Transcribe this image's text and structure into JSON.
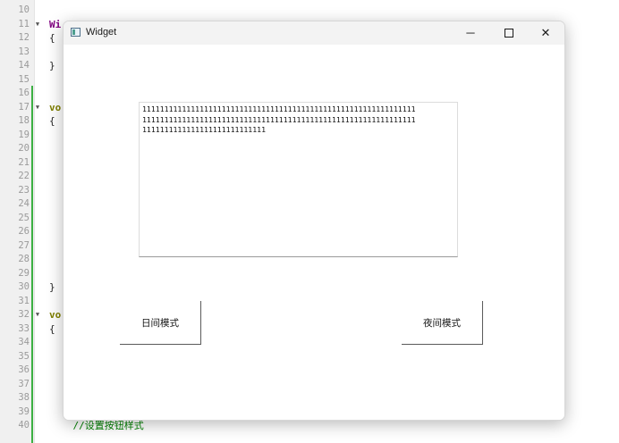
{
  "editor": {
    "lines": [
      {
        "n": "10",
        "text": "",
        "fold": ""
      },
      {
        "n": "11",
        "text": "Wi",
        "fold": "▼",
        "style": "kw-purple"
      },
      {
        "n": "12",
        "text": "{",
        "fold": ""
      },
      {
        "n": "13",
        "text": "",
        "fold": ""
      },
      {
        "n": "14",
        "text": "}",
        "fold": ""
      },
      {
        "n": "15",
        "text": "",
        "fold": ""
      },
      {
        "n": "16",
        "text": "",
        "fold": ""
      },
      {
        "n": "17",
        "text": "vo",
        "fold": "▼",
        "style": "kw-olive"
      },
      {
        "n": "18",
        "text": "{",
        "fold": ""
      },
      {
        "n": "19",
        "text": "",
        "fold": ""
      },
      {
        "n": "20",
        "text": "",
        "fold": ""
      },
      {
        "n": "21",
        "text": "",
        "fold": ""
      },
      {
        "n": "22",
        "text": "",
        "fold": ""
      },
      {
        "n": "23",
        "text": "",
        "fold": ""
      },
      {
        "n": "24",
        "text": "",
        "fold": ""
      },
      {
        "n": "25",
        "text": "",
        "fold": ""
      },
      {
        "n": "26",
        "text": "",
        "fold": ""
      },
      {
        "n": "27",
        "text": "",
        "fold": ""
      },
      {
        "n": "28",
        "text": "",
        "fold": ""
      },
      {
        "n": "29",
        "text": "",
        "fold": ""
      },
      {
        "n": "30",
        "text": "}",
        "fold": ""
      },
      {
        "n": "31",
        "text": "",
        "fold": ""
      },
      {
        "n": "32",
        "text": "vo",
        "fold": "▼",
        "style": "kw-olive"
      },
      {
        "n": "33",
        "text": "{",
        "fold": ""
      },
      {
        "n": "34",
        "text": "",
        "fold": ""
      },
      {
        "n": "35",
        "text": "",
        "fold": ""
      },
      {
        "n": "36",
        "text": "",
        "fold": ""
      },
      {
        "n": "37",
        "text": "",
        "fold": ""
      },
      {
        "n": "38",
        "text": "",
        "fold": ""
      },
      {
        "n": "39",
        "text": "",
        "fold": ""
      },
      {
        "n": "40",
        "text": "    //设置按钮样式",
        "fold": "",
        "style": "comment"
      }
    ]
  },
  "window": {
    "title": "Widget",
    "controls": {
      "minimize": "─",
      "close": "✕"
    },
    "text_edit": {
      "content": "11111111111111111111111111111111111111111111111111111111111111\n11111111111111111111111111111111111111111111111111111111111111\n1111111111111111111111111111"
    },
    "buttons": {
      "day_mode": "日间模式",
      "night_mode": "夜间模式"
    }
  },
  "colors": {
    "change_bar": "#3cb043",
    "keyword_purple": "#800080",
    "keyword_olive": "#808000",
    "comment": "#008000"
  }
}
